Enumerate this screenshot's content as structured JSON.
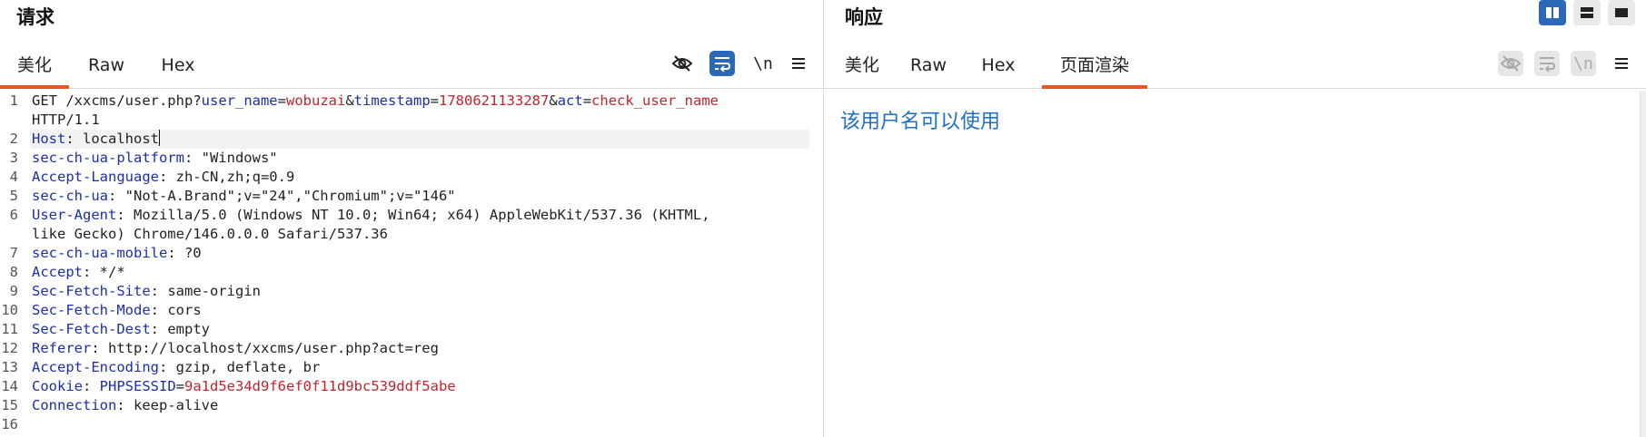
{
  "request": {
    "title": "请求",
    "tabs": [
      {
        "label": "美化",
        "active": true
      },
      {
        "label": "Raw",
        "active": false
      },
      {
        "label": "Hex",
        "active": false
      }
    ],
    "toolbar": {
      "newline_label": "\\n"
    },
    "lines": [
      {
        "num": "1",
        "segments": [
          {
            "t": "GET /xxcms/user.php",
            "c": "p"
          },
          {
            "t": "?",
            "c": "p"
          },
          {
            "t": "user_name",
            "c": "k"
          },
          {
            "t": "=",
            "c": "p"
          },
          {
            "t": "wobuzai",
            "c": "v"
          },
          {
            "t": "&",
            "c": "p"
          },
          {
            "t": "timestamp",
            "c": "k"
          },
          {
            "t": "=",
            "c": "p"
          },
          {
            "t": "1780621133287",
            "c": "v"
          },
          {
            "t": "&",
            "c": "p"
          },
          {
            "t": "act",
            "c": "k"
          },
          {
            "t": "=",
            "c": "p"
          },
          {
            "t": "check_user_name",
            "c": "v"
          }
        ]
      },
      {
        "num": "",
        "segments": [
          {
            "t": " HTTP/1.1",
            "c": "p"
          }
        ]
      },
      {
        "num": "2",
        "segments": [
          {
            "t": "Host",
            "c": "k"
          },
          {
            "t": ": localhost",
            "c": "p"
          }
        ]
      },
      {
        "num": "3",
        "segments": [
          {
            "t": "sec-ch-ua-platform",
            "c": "k"
          },
          {
            "t": ": \"Windows\"",
            "c": "p"
          }
        ]
      },
      {
        "num": "4",
        "segments": [
          {
            "t": "Accept-Language",
            "c": "k"
          },
          {
            "t": ": zh-CN,zh;q=0.9",
            "c": "p"
          }
        ]
      },
      {
        "num": "5",
        "segments": [
          {
            "t": "sec-ch-ua",
            "c": "k"
          },
          {
            "t": ": \"Not-A.Brand\";v=\"24\",\"Chromium\";v=\"146\"",
            "c": "p"
          }
        ]
      },
      {
        "num": "6",
        "segments": [
          {
            "t": "User-Agent",
            "c": "k"
          },
          {
            "t": ": Mozilla/5.0 (Windows NT 10.0; Win64; x64) AppleWebKit/537.36 (KHTML,",
            "c": "p"
          }
        ]
      },
      {
        "num": "",
        "segments": [
          {
            "t": "like Gecko) Chrome/146.0.0.0 Safari/537.36",
            "c": "p"
          }
        ]
      },
      {
        "num": "7",
        "segments": [
          {
            "t": "sec-ch-ua-mobile",
            "c": "k"
          },
          {
            "t": ": ?0",
            "c": "p"
          }
        ]
      },
      {
        "num": "8",
        "segments": [
          {
            "t": "Accept",
            "c": "k"
          },
          {
            "t": ": */*",
            "c": "p"
          }
        ]
      },
      {
        "num": "9",
        "segments": [
          {
            "t": "Sec-Fetch-Site",
            "c": "k"
          },
          {
            "t": ": same-origin",
            "c": "p"
          }
        ]
      },
      {
        "num": "10",
        "segments": [
          {
            "t": "Sec-Fetch-Mode",
            "c": "k"
          },
          {
            "t": ": cors",
            "c": "p"
          }
        ]
      },
      {
        "num": "11",
        "segments": [
          {
            "t": "Sec-Fetch-Dest",
            "c": "k"
          },
          {
            "t": ": empty",
            "c": "p"
          }
        ]
      },
      {
        "num": "12",
        "segments": [
          {
            "t": "Referer",
            "c": "k"
          },
          {
            "t": ": http://localhost/xxcms/user.php?act=reg",
            "c": "p"
          }
        ]
      },
      {
        "num": "13",
        "segments": [
          {
            "t": "Accept-Encoding",
            "c": "k"
          },
          {
            "t": ": gzip, deflate, br",
            "c": "p"
          }
        ]
      },
      {
        "num": "14",
        "segments": [
          {
            "t": "Cookie",
            "c": "k"
          },
          {
            "t": ": ",
            "c": "p"
          },
          {
            "t": "PHPSESSID",
            "c": "k"
          },
          {
            "t": "=",
            "c": "p"
          },
          {
            "t": "9a1d5e34d9f6ef0f11d9bc539ddf5abe",
            "c": "v"
          }
        ]
      },
      {
        "num": "15",
        "segments": [
          {
            "t": "Connection",
            "c": "k"
          },
          {
            "t": ": keep-alive",
            "c": "p"
          }
        ]
      },
      {
        "num": "16",
        "segments": []
      }
    ]
  },
  "response": {
    "title": "响应",
    "tabs": [
      {
        "label": "美化",
        "active": false
      },
      {
        "label": "Raw",
        "active": false
      },
      {
        "label": "Hex",
        "active": false
      },
      {
        "label": "页面渲染",
        "active": true
      }
    ],
    "toolbar": {
      "newline_label": "\\n"
    },
    "rendered_text": "该用户名可以使用"
  },
  "colors": {
    "accent_tab": "#e8572a",
    "active_button": "#2c68b8",
    "key": "#1b2fa8",
    "value": "#c4232c",
    "rendered_link": "#1f6fc4"
  }
}
